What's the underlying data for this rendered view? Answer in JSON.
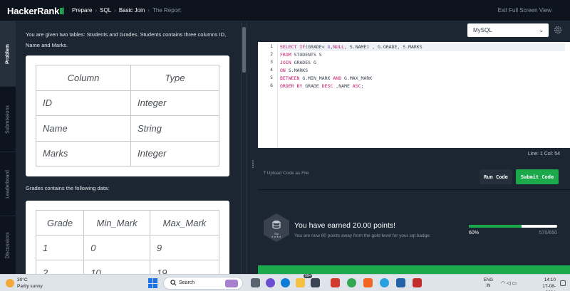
{
  "topbar": {
    "logo": "HackerRank",
    "breadcrumbs": [
      "Prepare",
      "SQL",
      "Basic Join",
      "The Report"
    ],
    "exit_fullscreen": "Exit Full Screen View"
  },
  "side_tabs": [
    "Problem",
    "Submissions",
    "Leaderboard",
    "Discussions"
  ],
  "problem": {
    "intro": "You are given two tables: Students and Grades. Students contains three columns ID, Name and Marks.",
    "students_table": {
      "headers": [
        "Column",
        "Type"
      ],
      "rows": [
        [
          "ID",
          "Integer"
        ],
        [
          "Name",
          "String"
        ],
        [
          "Marks",
          "Integer"
        ]
      ]
    },
    "grades_intro": "Grades contains the following data:",
    "grades_table": {
      "headers": [
        "Grade",
        "Min_Mark",
        "Max_Mark"
      ],
      "rows": [
        [
          "1",
          "0",
          "9"
        ],
        [
          "2",
          "10",
          "19"
        ]
      ]
    }
  },
  "editor": {
    "language": "MySQL",
    "lines": [
      "SELECT IF(GRADE< 8,NULL, S.NAME) , G.GRADE, S.MARKS",
      "FROM STUDENTS S",
      "JOIN GRADES G",
      "ON S.MARKS",
      "BETWEEN G.MIN_MARK AND G.MAX_MARK",
      "ORDER BY GRADE DESC ,NAME ASC;"
    ],
    "line_numbers": [
      "1",
      "2",
      "3",
      "4",
      "5",
      "6"
    ],
    "status": "Line: 1 Col: 54",
    "upload_label": "Upload Code as File",
    "run_label": "Run Code",
    "submit_label": "Submit Code"
  },
  "reward": {
    "badge_label": "Sql",
    "badge_stars": "★★★★",
    "title": "You have earned 20.00 points!",
    "subtitle": "You are now 80 points away from the gold level for your sql badge.",
    "progress_percent": 60,
    "progress_label": "60%",
    "progress_value": "570/650"
  },
  "taskbar": {
    "weather_temp": "30°C",
    "weather_cond": "Partly sunny",
    "search_label": "Search",
    "lang_line1": "ENG",
    "lang_line2": "IN",
    "time": "14:10",
    "date": "17-08-2024",
    "app_badge": "99+"
  },
  "colors": {
    "background": "#0e141e",
    "panel": "#1c2532",
    "accent": "#1ba94c",
    "windows_blue": "#1a73e8"
  }
}
